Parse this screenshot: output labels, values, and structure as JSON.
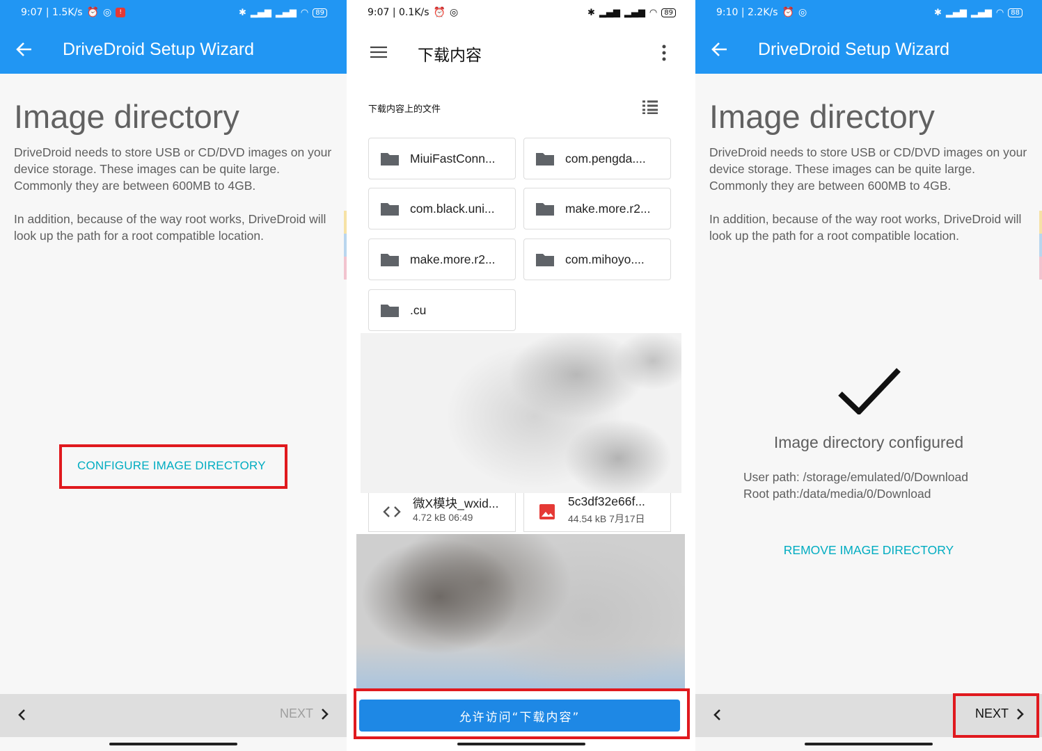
{
  "colors": {
    "appbar": "#2196f3",
    "accent": "#00acc1",
    "highlight_box": "#e0191e",
    "allow_button": "#1e88e5"
  },
  "panel1": {
    "status": {
      "time": "9:07 | 1.5K/s",
      "battery": "89"
    },
    "appbar": {
      "title": "DriveDroid Setup Wizard",
      "back_icon": "arrow-back-icon"
    },
    "heading": "Image directory",
    "paragraph1": "DriveDroid needs to store USB or CD/DVD images on your device storage. These images can be quite large. Commonly they are between 600MB to 4GB.",
    "paragraph2": " In addition, because of the way root works, DriveDroid will look up the path for a root compatible location.",
    "configure_button": "CONFIGURE IMAGE DIRECTORY",
    "next_label": "NEXT"
  },
  "panel2": {
    "status": {
      "time": "9:07 | 0.1K/s",
      "battery": "89"
    },
    "title": "下载内容",
    "subtitle": "下载内容上的文件",
    "folders": [
      "MiuiFastConn...",
      "com.pengda....",
      "com.black.uni...",
      "make.more.r2...",
      "make.more.r2...",
      "com.mihoyo....",
      ".cu"
    ],
    "files": [
      {
        "name": "微X模块_wxid...",
        "meta": "4.72 kB 06:49",
        "icon": "code-icon"
      },
      {
        "name": "5c3df32e66f...",
        "meta": "44.54 kB 7月17日",
        "icon": "image-file-icon"
      }
    ],
    "allow_button": "允许访问“下载内容”"
  },
  "panel3": {
    "status": {
      "time": "9:10 | 2.2K/s",
      "battery": "88"
    },
    "appbar": {
      "title": "DriveDroid Setup Wizard"
    },
    "heading": "Image directory",
    "paragraph1": "DriveDroid needs to store USB or CD/DVD images on your device storage. These images can be quite large. Commonly they are between 600MB to 4GB.",
    "paragraph2": " In addition, because of the way root works, DriveDroid will look up the path for a root compatible location.",
    "configured_text": "Image directory configured",
    "user_path": "User path: /storage/emulated/0/Download",
    "root_path": "Root path:/data/media/0/Download",
    "remove_button": "REMOVE IMAGE DIRECTORY",
    "next_label": "NEXT"
  }
}
